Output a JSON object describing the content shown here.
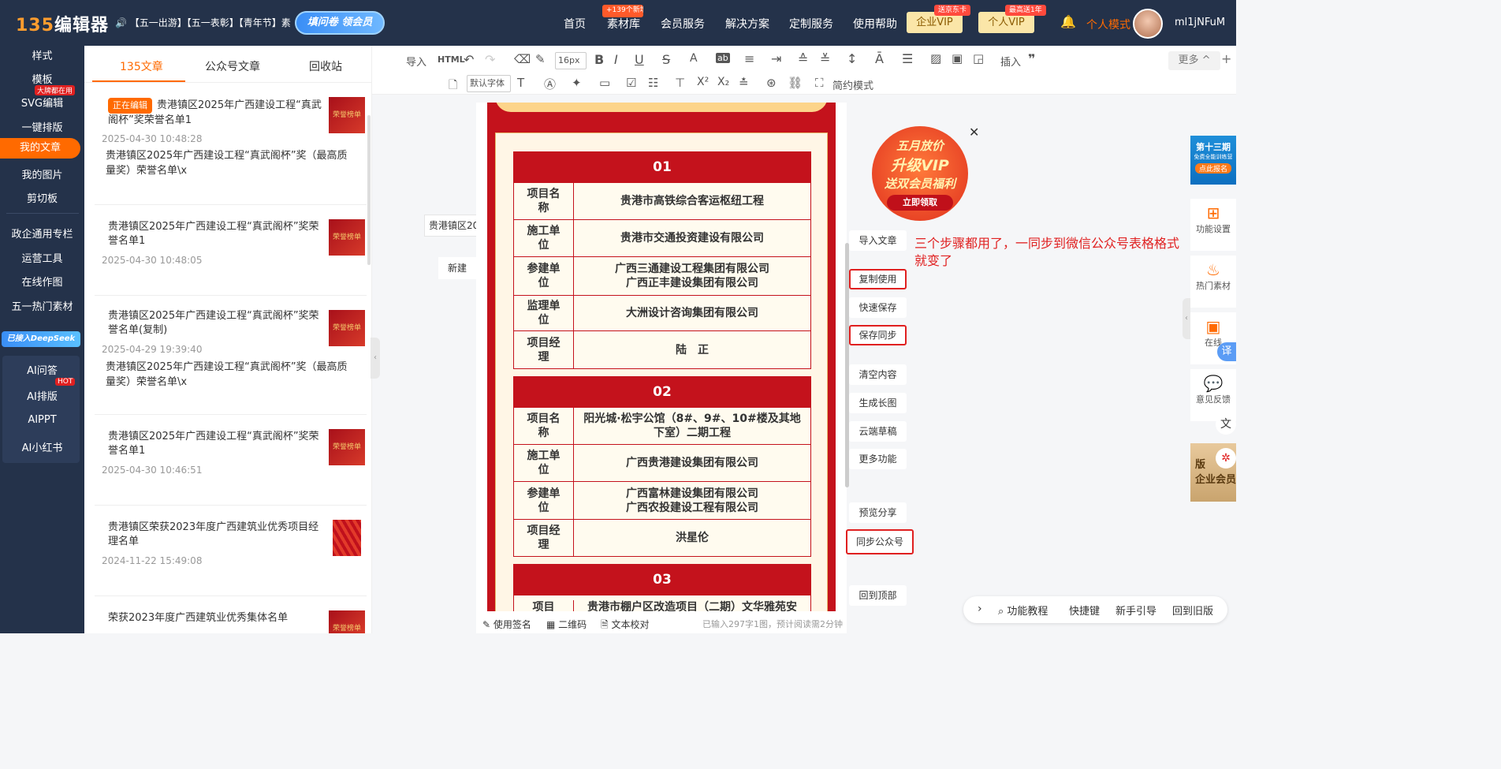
{
  "topbar": {
    "logo": "135编辑器",
    "logo_num": "135",
    "logo_text": "编辑器",
    "notice": "【五一出游】【五一表彰】【青年节】素",
    "quiz_label": "填问卷 领会员",
    "nav": [
      "首页",
      "素材库",
      "会员服务",
      "解决方案",
      "定制服务",
      "使用帮助"
    ],
    "nav_badge": "+139个新增样式",
    "vip_enterprise": "企业VIP",
    "vip_enterprise_badge": "送京东卡",
    "vip_personal": "个人VIP",
    "vip_personal_badge": "最高送1年",
    "mode": "个人模式",
    "username": "ml1jNFuM"
  },
  "leftnav": {
    "items": [
      "样式",
      "模板",
      "SVG编辑",
      "一键排版",
      "我的文章",
      "我的图片",
      "剪切板",
      "政企通用专栏",
      "运营工具",
      "在线作图",
      "五一热门素材"
    ],
    "svg_badge": "大牌都在用",
    "deepseek": "已接入DeepSeek",
    "ai_items": [
      "AI问答",
      "AI排版",
      "AIPPT",
      "AI小红书"
    ],
    "hot": "HOT"
  },
  "articles": {
    "tabs": [
      "135文章",
      "公众号文章",
      "回收站"
    ],
    "editing_tag": "正在编辑",
    "list": [
      {
        "title": "贵港镇区2025年广西建设工程“真武阁杯”奖荣誉名单1",
        "date": "2025-04-30 10:48:28",
        "desc": "贵港镇区2025年广西建设工程“真武阁杯”奖（最高质量奖）荣誉名单\\x",
        "thumb": "荣誉榜单"
      },
      {
        "title": "贵港镇区2025年广西建设工程“真武阁杯”奖荣誉名单1",
        "date": "2025-04-30 10:48:05",
        "desc": "",
        "thumb": "荣誉榜单"
      },
      {
        "title": "贵港镇区2025年广西建设工程“真武阁杯”奖荣誉名单(复制)",
        "date": "2025-04-29 19:39:40",
        "desc": "贵港镇区2025年广西建设工程“真武阁杯”奖（最高质量奖）荣誉名单\\x",
        "thumb": "荣誉榜单"
      },
      {
        "title": "贵港镇区2025年广西建设工程“真武阁杯”奖荣誉名单1",
        "date": "2025-04-30 10:46:51",
        "desc": "",
        "thumb": "荣誉榜单"
      },
      {
        "title": "贵港镇区荣获2023年度广西建筑业优秀项目经理名单",
        "date": "2024-11-22 15:49:08",
        "desc": "",
        "thumb": ""
      },
      {
        "title": "荣获2023年度广西建筑业优秀集体名单",
        "date": "",
        "desc": "",
        "thumb": "荣誉榜单"
      }
    ]
  },
  "toolbar": {
    "import": "导入",
    "html": "HTML",
    "font_size": "16px",
    "insert": "插入",
    "more": "更多",
    "default_font": "默认字体",
    "simple_mode": "简约模式"
  },
  "doc": {
    "title_snippet": "贵港镇区20",
    "new_label": "新建",
    "sections": [
      {
        "num": "01",
        "rows": [
          [
            "项目名称",
            "贵港市高铁综合客运枢纽工程"
          ],
          [
            "施工单位",
            "贵港市交通投资建设有限公司"
          ],
          [
            "参建单位",
            "广西三通建设工程集团有限公司\n广西正丰建设集团有限公司"
          ],
          [
            "监理单位",
            "大洲设计咨询集团有限公司"
          ],
          [
            "项目经理",
            "陆　正"
          ]
        ]
      },
      {
        "num": "02",
        "rows": [
          [
            "项目名称",
            "阳光城·松宇公馆（8#、9#、10#楼及其地下室）二期工程"
          ],
          [
            "施工单位",
            "广西贵港建设集团有限公司"
          ],
          [
            "参建单位",
            "广西富林建设集团有限公司\n广西农投建设工程有限公司"
          ],
          [
            "项目经理",
            "洪星伦"
          ]
        ]
      },
      {
        "num": "03",
        "rows": [
          [
            "项目",
            "贵港市棚户区改造项目（二期）文华雅苑安"
          ]
        ]
      }
    ]
  },
  "edfoot": {
    "sign": "使用签名",
    "qrcode": "二维码",
    "proof": "文本校对",
    "count": "已输入297字1图，预计阅读需2分钟"
  },
  "actions": [
    "导入文章",
    "复制使用",
    "快速保存",
    "保存同步",
    "清空内容",
    "生成长图",
    "云端草稿",
    "更多功能",
    "预览分享",
    "同步公众号",
    "回到顶部"
  ],
  "promo": {
    "line1": "五月放价",
    "line2": "升级VIP",
    "line3": "送双会员福利",
    "btn": "立即领取"
  },
  "annotation": "三个步骤都用了，一同步到微信公众号表格格式就变了",
  "rightpanel": {
    "banner": "第十三期",
    "banner2": "免费全能训练营",
    "banner_btn": "点此报名",
    "items": [
      "功能设置",
      "热门素材",
      "在线",
      "意见反馈"
    ],
    "translate": "译",
    "bottom_banner": "版",
    "bottom_banner2": "企业会员"
  },
  "bottombar": [
    "功能教程",
    "快捷键",
    "新手引导",
    "回到旧版"
  ]
}
